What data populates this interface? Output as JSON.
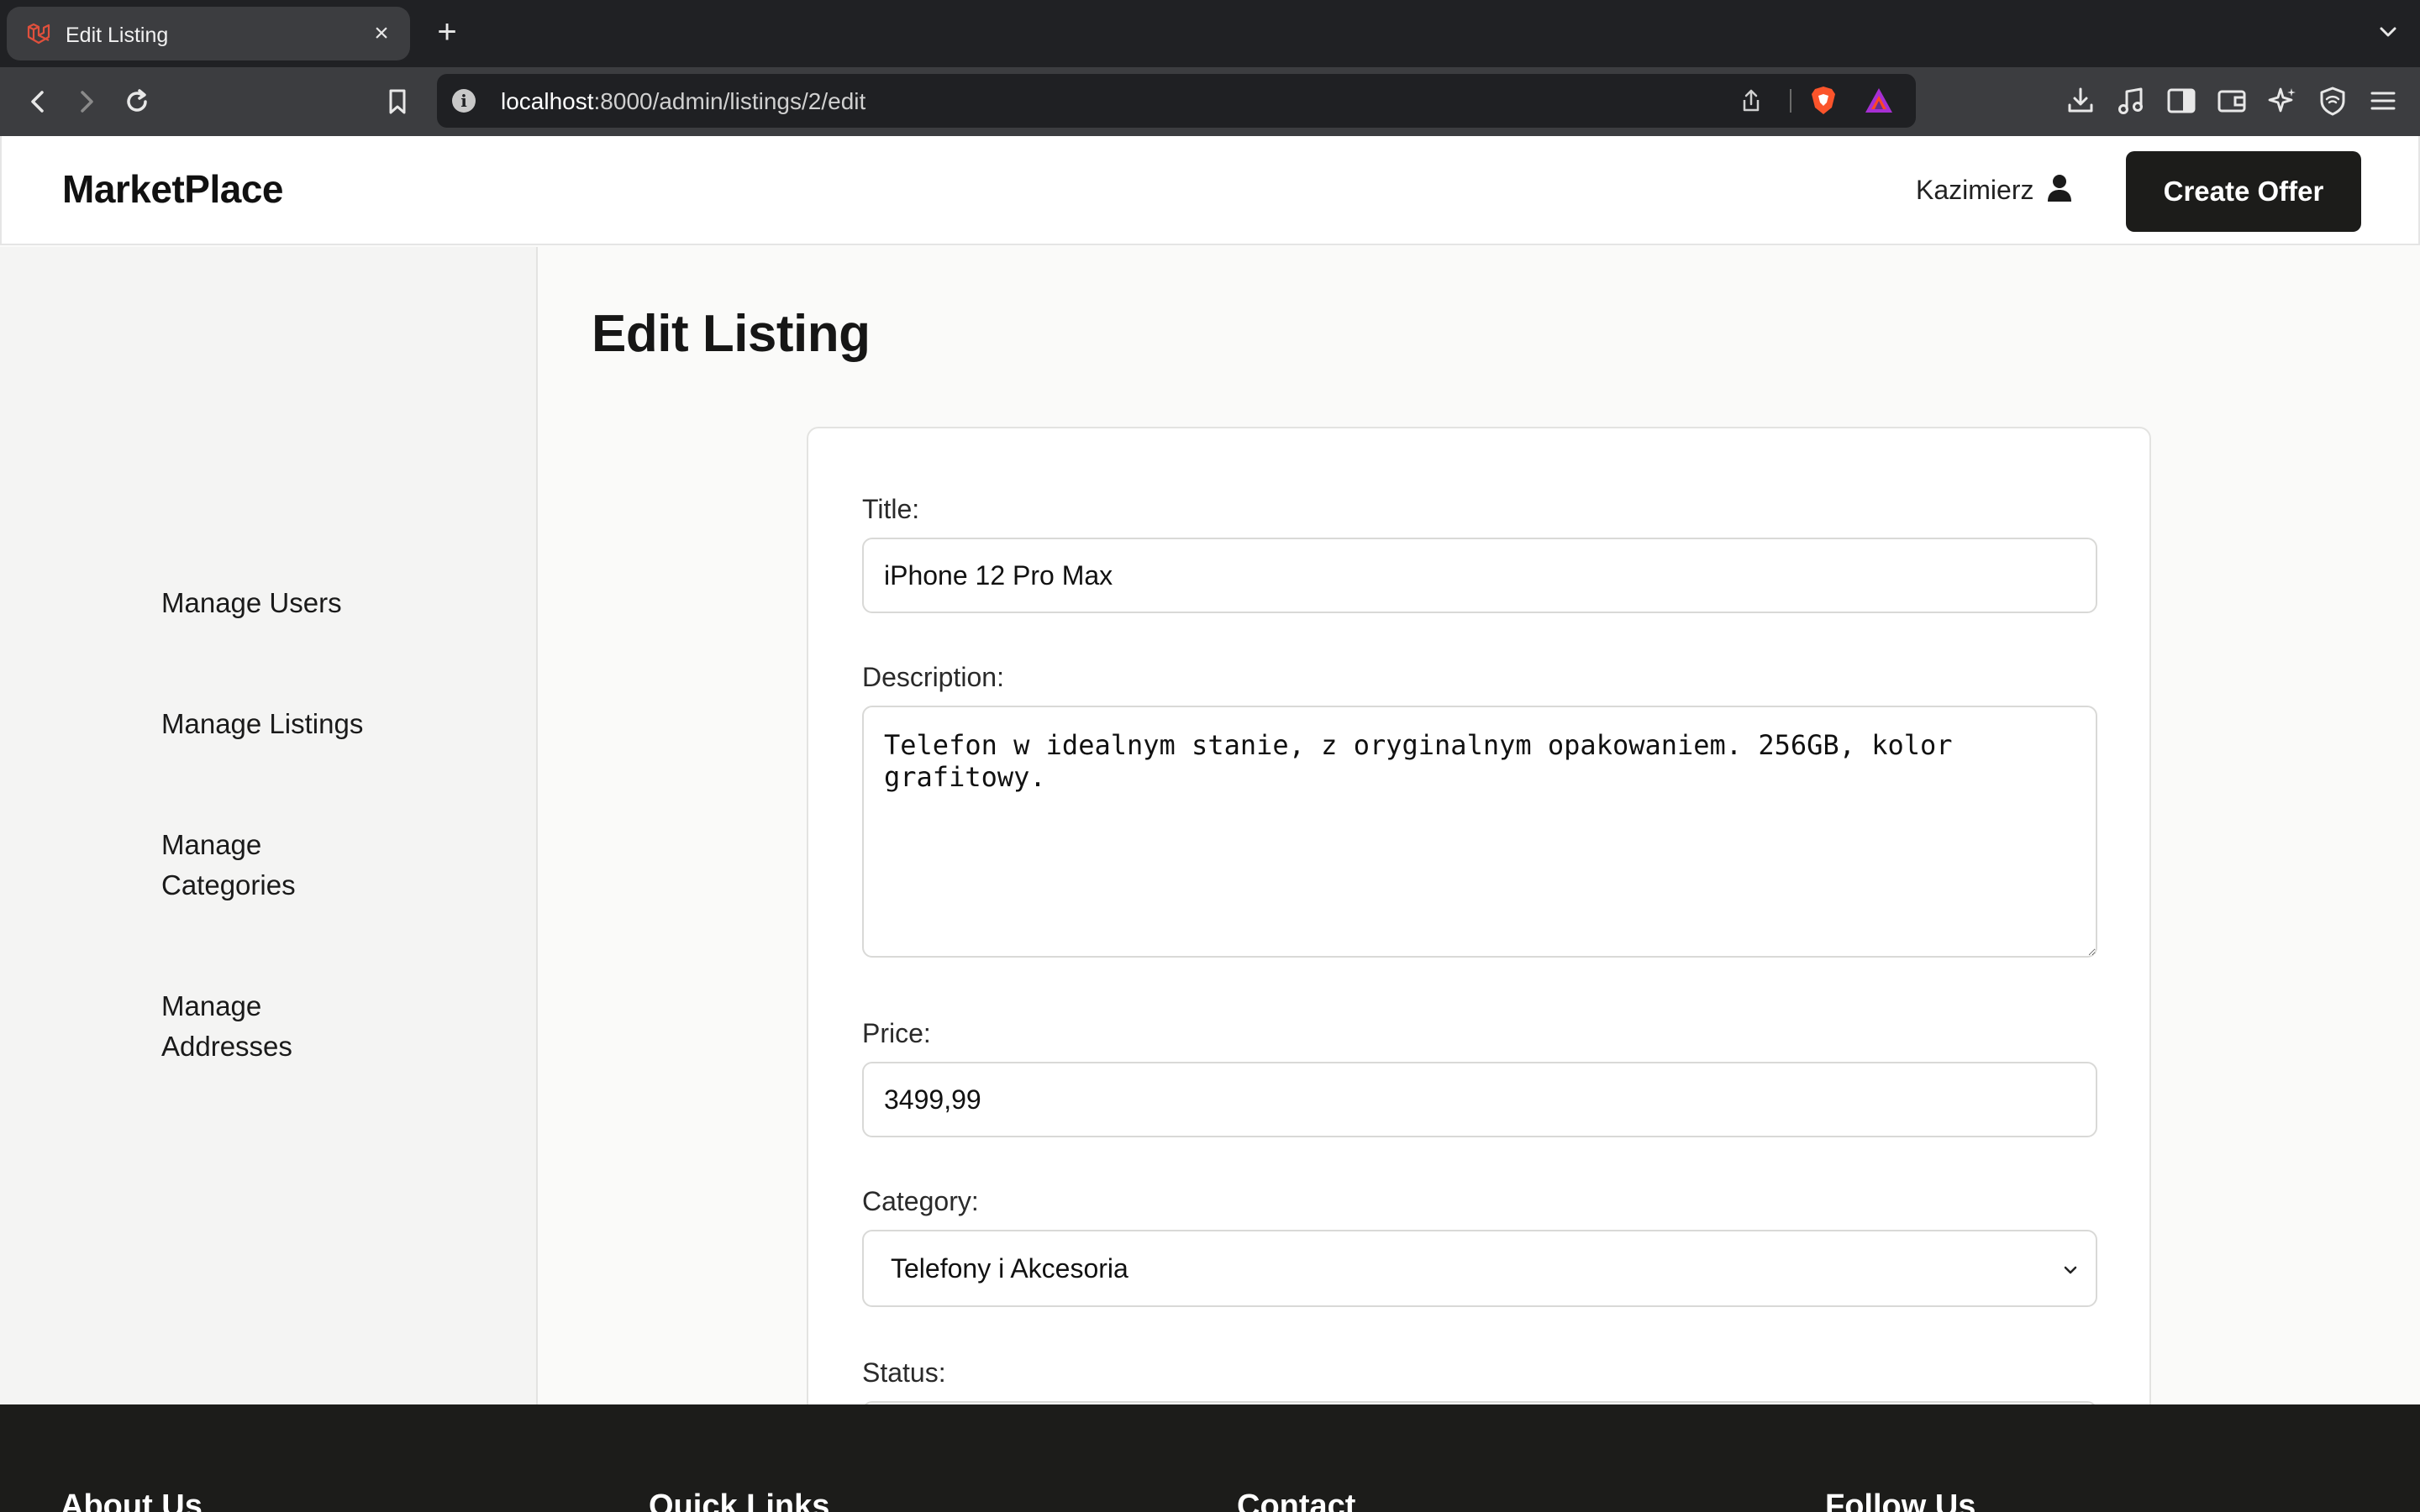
{
  "browser": {
    "tab_title": "Edit Listing",
    "new_tab": "+",
    "close_glyph": "×",
    "url_host": "localhost",
    "url_rest": ":8000/admin/listings/2/edit",
    "info_glyph": "i"
  },
  "header": {
    "brand": "MarketPlace",
    "user_name": "Kazimierz",
    "create_offer": "Create Offer"
  },
  "sidebar": {
    "items": [
      {
        "label": "Manage Users"
      },
      {
        "label": "Manage Listings"
      },
      {
        "label": "Manage Categories"
      },
      {
        "label": "Manage Addresses"
      }
    ]
  },
  "main": {
    "page_title": "Edit Listing",
    "form": {
      "title_label": "Title:",
      "title_value": "iPhone 12 Pro Max",
      "description_label": "Description:",
      "description_value": "Telefon w idealnym stanie, z oryginalnym opakowaniem. 256GB, kolor grafitowy.",
      "price_label": "Price:",
      "price_value": "3499,99",
      "category_label": "Category:",
      "category_value": "Telefony i Akcesoria",
      "status_label": "Status:"
    }
  },
  "footer": {
    "headings": [
      "About Us",
      "Quick Links",
      "Contact",
      "Follow Us"
    ]
  },
  "colors": {
    "brand_dark": "#1c1c1a",
    "sidebar_bg": "#f4f4f3",
    "browser_chrome": "#3c3d40"
  }
}
